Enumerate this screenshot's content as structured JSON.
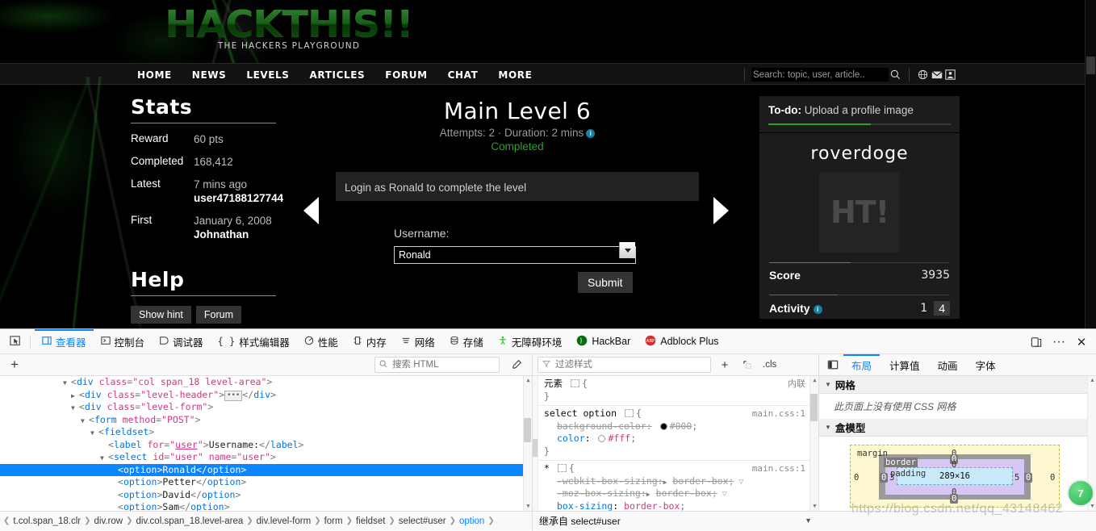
{
  "site": {
    "logo": "HACKTHIS!!",
    "tagline": "THE HACKERS PLAYGROUND",
    "nav": [
      "HOME",
      "NEWS",
      "LEVELS",
      "ARTICLES",
      "FORUM",
      "CHAT",
      "MORE"
    ],
    "search_placeholder": "Search: topic, user, article..",
    "icons": [
      "search-icon",
      "globe-icon",
      "envelope-icon",
      "user-icon"
    ]
  },
  "stats": {
    "title": "Stats",
    "rows": [
      {
        "key": "Reward",
        "value": "60 pts",
        "sub": ""
      },
      {
        "key": "Completed",
        "value": "168,412",
        "sub": ""
      },
      {
        "key": "Latest",
        "value": "7 mins ago",
        "sub": "user47188127744"
      },
      {
        "key": "First",
        "value": "January 6, 2008",
        "sub": "Johnathan"
      }
    ]
  },
  "help": {
    "title": "Help",
    "buttons": [
      "Show hint",
      "Forum"
    ]
  },
  "level": {
    "title": "Main Level 6",
    "meta": "Attempts: 2 · Duration: 2 mins",
    "status": "Completed",
    "message": "Login as Ronald to complete the level",
    "form": {
      "label": "Username:",
      "selected": "Ronald",
      "options": [
        "Ronald",
        "Petter",
        "David",
        "Sam"
      ],
      "submit": "Submit"
    }
  },
  "profile": {
    "todo_key": "To-do:",
    "todo_text": "Upload a profile image",
    "username": "roverdoge",
    "avatar_text": "HT!",
    "score_label": "Score",
    "score_value": "3935",
    "activity_label": "Activity",
    "activity_left": "1",
    "activity_right": "4"
  },
  "devtools": {
    "tabs": [
      {
        "label": "查看器",
        "icon": "inspector-icon",
        "active": true
      },
      {
        "label": "控制台",
        "icon": "console-icon",
        "active": false
      },
      {
        "label": "调试器",
        "icon": "debugger-icon",
        "active": false
      },
      {
        "label": "样式编辑器",
        "icon": "style-editor-icon",
        "active": false
      },
      {
        "label": "性能",
        "icon": "performance-icon",
        "active": false
      },
      {
        "label": "内存",
        "icon": "memory-icon",
        "active": false
      },
      {
        "label": "网络",
        "icon": "network-icon",
        "active": false
      },
      {
        "label": "存储",
        "icon": "storage-icon",
        "active": false
      },
      {
        "label": "无障碍环境",
        "icon": "accessibility-icon",
        "active": false
      },
      {
        "label": "HackBar",
        "icon": "hackbar-icon",
        "active": false
      },
      {
        "label": "Adblock Plus",
        "icon": "adblock-icon",
        "active": false
      }
    ],
    "html_search_placeholder": "搜索 HTML",
    "css_filter_placeholder": "过滤样式",
    "cls_label": ".cls",
    "layout_tabs": [
      "布局",
      "计算值",
      "动画",
      "字体"
    ],
    "layout_active": "布局",
    "markup": [
      {
        "indent": 5,
        "twisty": "open",
        "parts": [
          [
            "punc",
            "<"
          ],
          [
            "tag",
            "div"
          ],
          [
            "punc",
            " "
          ],
          [
            "attr",
            "class"
          ],
          [
            "punc",
            "="
          ],
          [
            "val",
            "\"col span_18 level-area\""
          ],
          [
            "punc",
            ">"
          ]
        ]
      },
      {
        "indent": 6,
        "twisty": "closed",
        "parts": [
          [
            "punc",
            "<"
          ],
          [
            "tag",
            "div"
          ],
          [
            "punc",
            " "
          ],
          [
            "attr",
            "class"
          ],
          [
            "punc",
            "="
          ],
          [
            "val",
            "\"level-header\""
          ],
          [
            "punc",
            ">"
          ],
          [
            "ellipsis",
            ""
          ],
          [
            "punc",
            "</"
          ],
          [
            "tag",
            "div"
          ],
          [
            "punc",
            ">"
          ]
        ]
      },
      {
        "indent": 6,
        "twisty": "open",
        "parts": [
          [
            "punc",
            "<"
          ],
          [
            "tag",
            "div"
          ],
          [
            "punc",
            " "
          ],
          [
            "attr",
            "class"
          ],
          [
            "punc",
            "="
          ],
          [
            "val",
            "\"level-form\""
          ],
          [
            "punc",
            ">"
          ]
        ]
      },
      {
        "indent": 7,
        "twisty": "open",
        "parts": [
          [
            "punc",
            "<"
          ],
          [
            "tag",
            "form"
          ],
          [
            "punc",
            " "
          ],
          [
            "attr",
            "method"
          ],
          [
            "punc",
            "="
          ],
          [
            "val",
            "\"POST\""
          ],
          [
            "punc",
            ">"
          ]
        ]
      },
      {
        "indent": 8,
        "twisty": "open",
        "parts": [
          [
            "punc",
            "<"
          ],
          [
            "tag",
            "fieldset"
          ],
          [
            "punc",
            ">"
          ]
        ]
      },
      {
        "indent": 10,
        "twisty": "none",
        "parts": [
          [
            "punc",
            "<"
          ],
          [
            "tag",
            "label"
          ],
          [
            "punc",
            " "
          ],
          [
            "attr",
            "for"
          ],
          [
            "punc",
            "="
          ],
          [
            "valu",
            "\"user\""
          ],
          [
            "punc",
            ">"
          ],
          [
            "txt",
            "Username:"
          ],
          [
            "punc",
            "</"
          ],
          [
            "tag",
            "label"
          ],
          [
            "punc",
            ">"
          ]
        ]
      },
      {
        "indent": 9,
        "twisty": "open",
        "parts": [
          [
            "punc",
            "<"
          ],
          [
            "tag",
            "select"
          ],
          [
            "punc",
            " "
          ],
          [
            "attr",
            "id"
          ],
          [
            "punc",
            "="
          ],
          [
            "val",
            "\"user\""
          ],
          [
            "punc",
            " "
          ],
          [
            "attr",
            "name"
          ],
          [
            "punc",
            "="
          ],
          [
            "val",
            "\"user\""
          ],
          [
            "punc",
            ">"
          ]
        ]
      },
      {
        "indent": 11,
        "twisty": "none",
        "selected": true,
        "parts": [
          [
            "punc",
            "<"
          ],
          [
            "tag",
            "option"
          ],
          [
            "punc",
            ">"
          ],
          [
            "txt",
            "Ronald"
          ],
          [
            "punc",
            "</"
          ],
          [
            "tag",
            "option"
          ],
          [
            "punc",
            ">"
          ]
        ]
      },
      {
        "indent": 11,
        "twisty": "none",
        "parts": [
          [
            "punc",
            "<"
          ],
          [
            "tag",
            "option"
          ],
          [
            "punc",
            ">"
          ],
          [
            "txt",
            "Petter"
          ],
          [
            "punc",
            "</"
          ],
          [
            "tag",
            "option"
          ],
          [
            "punc",
            ">"
          ]
        ]
      },
      {
        "indent": 11,
        "twisty": "none",
        "parts": [
          [
            "punc",
            "<"
          ],
          [
            "tag",
            "option"
          ],
          [
            "punc",
            ">"
          ],
          [
            "txt",
            "David"
          ],
          [
            "punc",
            "</"
          ],
          [
            "tag",
            "option"
          ],
          [
            "punc",
            ">"
          ]
        ]
      },
      {
        "indent": 11,
        "twisty": "none",
        "parts": [
          [
            "punc",
            "<"
          ],
          [
            "tag",
            "option"
          ],
          [
            "punc",
            ">"
          ],
          [
            "txt",
            "Sam"
          ],
          [
            "punc",
            "</"
          ],
          [
            "tag",
            "option"
          ],
          [
            "punc",
            ">"
          ]
        ]
      }
    ],
    "rules": [
      {
        "selector": "元素",
        "origin": "内联",
        "declarations": []
      },
      {
        "selector": "select option",
        "origin": "main.css:1",
        "declarations": [
          {
            "prop": "background-color",
            "value": "#000",
            "swatch": "#000000",
            "overridden": true
          },
          {
            "prop": "color",
            "value": "#fff",
            "swatch": "#ffffff",
            "overridden": false
          }
        ]
      },
      {
        "selector": "*",
        "origin": "main.css:1",
        "declarations": [
          {
            "prop": "-webkit-box-sizing",
            "value": "border-box",
            "overridden": true,
            "funnel": true,
            "expand": true
          },
          {
            "prop": "-moz-box-sizing",
            "value": "border-box",
            "overridden": true,
            "funnel": true,
            "expand": true
          },
          {
            "prop": "box-sizing",
            "value": "border-box",
            "overridden": false
          }
        ]
      }
    ],
    "layout": {
      "grid_header": "网格",
      "grid_empty": "此页面上没有使用 CSS 网格",
      "box_header": "盒模型",
      "box": {
        "margin_label": "margin",
        "border_label": "border",
        "padding_label": "padding",
        "content": "289×16",
        "margin": {
          "top": "0",
          "right": "0",
          "bottom": "0",
          "left": "0"
        },
        "border": {
          "top": "0",
          "right": "0",
          "bottom": "0",
          "left": "0"
        },
        "padding": {
          "top": "0",
          "right": "5",
          "bottom": "0",
          "left": "3"
        }
      }
    },
    "breadcrumbs": [
      {
        "label": "t.col.span_18.clr",
        "active": false
      },
      {
        "label": "div.row",
        "active": false
      },
      {
        "label": "div.col.span_18.level-area",
        "active": false
      },
      {
        "label": "div.level-form",
        "active": false
      },
      {
        "label": "form",
        "active": false
      },
      {
        "label": "fieldset",
        "active": false
      },
      {
        "label": "select#user",
        "active": false
      },
      {
        "label": "option",
        "active": true
      }
    ],
    "inherit_label": "继承自 select#user",
    "green_badge": "7"
  },
  "watermark": "https://blog.csdn.net/qq_43148462"
}
